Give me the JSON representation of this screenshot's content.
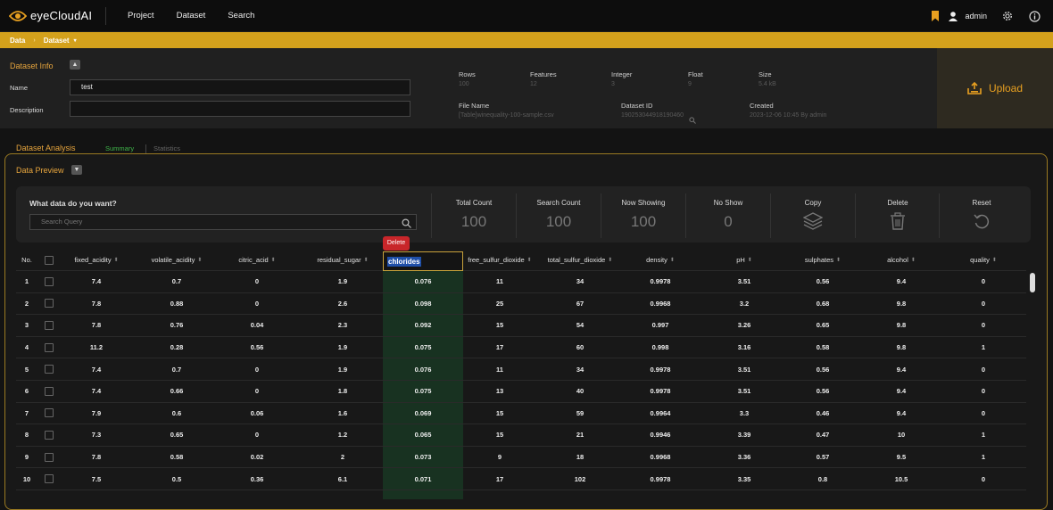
{
  "app": {
    "name": "eyeCloudAI",
    "accent": "#d4a11c"
  },
  "nav": [
    "Project",
    "Dataset",
    "Search"
  ],
  "user": {
    "name": "admin"
  },
  "breadcrumb": {
    "items": [
      "Data",
      "Dataset"
    ],
    "separator": "›",
    "caret": "▾"
  },
  "dataset_info": {
    "title": "Dataset Info",
    "name_label": "Name",
    "name_value": "test",
    "description_label": "Description",
    "description_value": "",
    "rows_label": "Rows",
    "rows_value": "100",
    "features_label": "Features",
    "features_value": "12",
    "integer_label": "Integer",
    "integer_value": "3",
    "float_label": "Float",
    "float_value": "9",
    "size_label": "Size",
    "size_value": "5.4 kB",
    "file_name_label": "File Name",
    "file_name_value": "[Table]winequality-100-sample.csv",
    "dataset_id_label": "Dataset ID",
    "dataset_id_value": "190253044918190460",
    "created_label": "Created",
    "created_value": "2023-12-06 10:45 By admin",
    "upload_label": "Upload"
  },
  "analysis": {
    "title": "Dataset Analysis",
    "tabs": [
      "Summary",
      "Statistics"
    ],
    "active_tab": "Summary",
    "active_color": "#3fb54a"
  },
  "preview": {
    "title": "Data Preview",
    "query_label": "What data do you want?",
    "query_placeholder": "Search Query",
    "stats": [
      {
        "label": "Total Count",
        "value": "100"
      },
      {
        "label": "Search Count",
        "value": "100"
      },
      {
        "label": "Now Showing",
        "value": "100"
      },
      {
        "label": "No Show",
        "value": "0"
      }
    ],
    "actions": {
      "copy": "Copy",
      "delete": "Delete",
      "reset": "Reset"
    },
    "delete_tooltip": "Delete",
    "no_label": "No.",
    "columns": [
      "fixed_acidity",
      "volatile_acidity",
      "citric_acid",
      "residual_sugar",
      "chlorides",
      "free_sulfur_dioxide",
      "total_sulfur_dioxide",
      "density",
      "pH",
      "sulphates",
      "alcohol",
      "quality"
    ],
    "selected_column": "chlorides",
    "rows": [
      [
        "1",
        "7.4",
        "0.7",
        "0",
        "1.9",
        "0.076",
        "11",
        "34",
        "0.9978",
        "3.51",
        "0.56",
        "9.4",
        "0"
      ],
      [
        "2",
        "7.8",
        "0.88",
        "0",
        "2.6",
        "0.098",
        "25",
        "67",
        "0.9968",
        "3.2",
        "0.68",
        "9.8",
        "0"
      ],
      [
        "3",
        "7.8",
        "0.76",
        "0.04",
        "2.3",
        "0.092",
        "15",
        "54",
        "0.997",
        "3.26",
        "0.65",
        "9.8",
        "0"
      ],
      [
        "4",
        "11.2",
        "0.28",
        "0.56",
        "1.9",
        "0.075",
        "17",
        "60",
        "0.998",
        "3.16",
        "0.58",
        "9.8",
        "1"
      ],
      [
        "5",
        "7.4",
        "0.7",
        "0",
        "1.9",
        "0.076",
        "11",
        "34",
        "0.9978",
        "3.51",
        "0.56",
        "9.4",
        "0"
      ],
      [
        "6",
        "7.4",
        "0.66",
        "0",
        "1.8",
        "0.075",
        "13",
        "40",
        "0.9978",
        "3.51",
        "0.56",
        "9.4",
        "0"
      ],
      [
        "7",
        "7.9",
        "0.6",
        "0.06",
        "1.6",
        "0.069",
        "15",
        "59",
        "0.9964",
        "3.3",
        "0.46",
        "9.4",
        "0"
      ],
      [
        "8",
        "7.3",
        "0.65",
        "0",
        "1.2",
        "0.065",
        "15",
        "21",
        "0.9946",
        "3.39",
        "0.47",
        "10",
        "1"
      ],
      [
        "9",
        "7.8",
        "0.58",
        "0.02",
        "2",
        "0.073",
        "9",
        "18",
        "0.9968",
        "3.36",
        "0.57",
        "9.5",
        "1"
      ],
      [
        "10",
        "7.5",
        "0.5",
        "0.36",
        "6.1",
        "0.071",
        "17",
        "102",
        "0.9978",
        "3.35",
        "0.8",
        "10.5",
        "0"
      ]
    ]
  }
}
